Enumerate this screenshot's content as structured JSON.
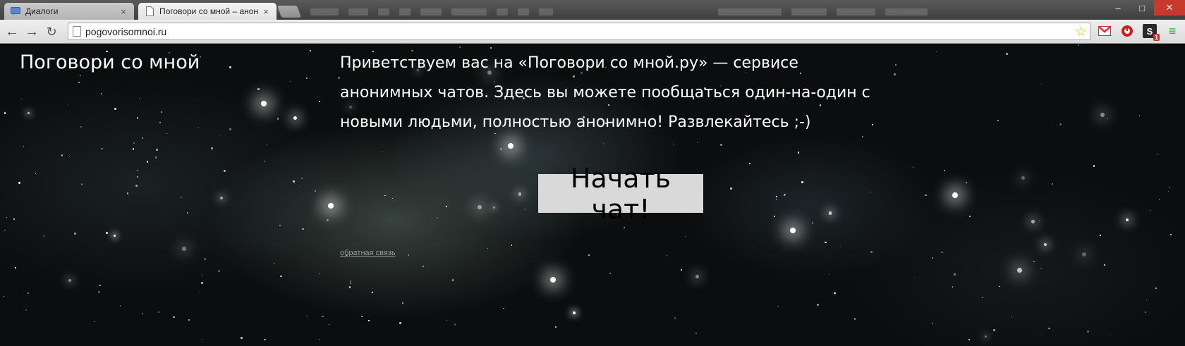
{
  "browser": {
    "tabs": [
      {
        "title": "Диалоги",
        "active": false
      },
      {
        "title": "Поговори со мной – анонимный чат",
        "active": true
      }
    ],
    "url": "pogovorisomnoi.ru",
    "extensions": [
      "gmail-icon",
      "opera-icon",
      "script-icon",
      "menu-icon"
    ],
    "extension_badge": "1"
  },
  "page": {
    "site_title": "Поговори со мной",
    "intro_text": "Приветствуем вас на «Поговори со мной.ру» — сервисе анонимных чатов. Здесь вы можете пообщаться один-на-один с новыми людьми, полностью анонимно! Развлекайтесь ;-)",
    "start_button": "Начать чат!",
    "feedback_link": "обратная связь"
  },
  "colors": {
    "title_text": "#ffffff",
    "button_bg": "#d9d9d9",
    "link": "#9a9a9a",
    "star_bookmark": "#f1b400",
    "window_close": "#c7392b"
  }
}
